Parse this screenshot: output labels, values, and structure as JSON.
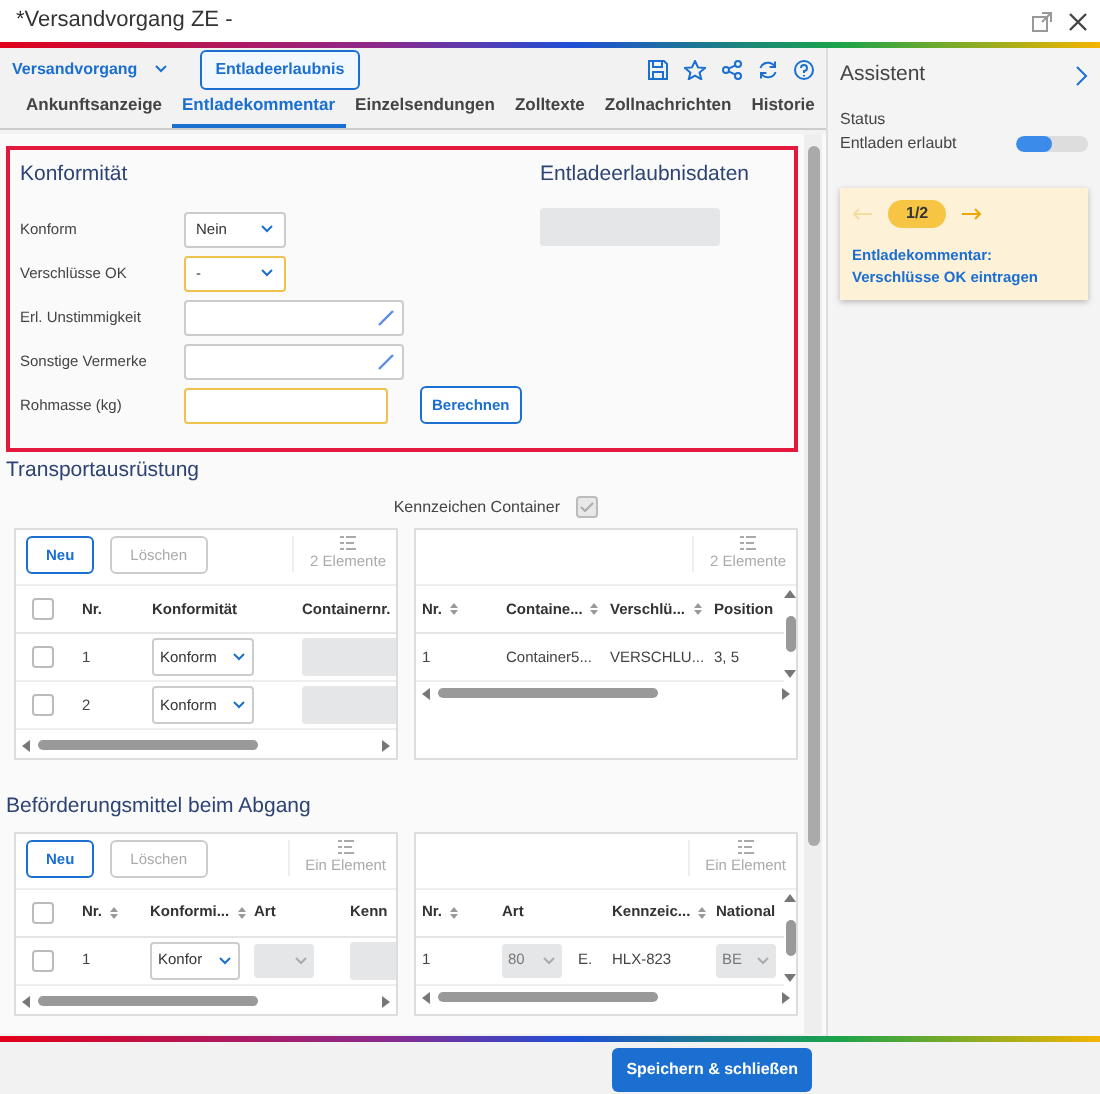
{
  "window": {
    "title": "*Versandvorgang ZE -"
  },
  "toolbar": {
    "menu": "Versandvorgang",
    "button": "Entladeerlaubnis"
  },
  "tabs": [
    {
      "label": "Ankunftsanzeige",
      "selected": false
    },
    {
      "label": "Entladekommentar",
      "selected": true
    },
    {
      "label": "Einzelsendungen",
      "selected": false
    },
    {
      "label": "Zolltexte",
      "selected": false
    },
    {
      "label": "Zollnachrichten",
      "selected": false
    },
    {
      "label": "Historie",
      "selected": false
    }
  ],
  "konformitaet": {
    "title": "Konformität",
    "highlighted": true,
    "fields": [
      {
        "label": "Konform",
        "kind": "select",
        "value": "Nein",
        "required": false
      },
      {
        "label": "Verschlüsse OK",
        "kind": "select",
        "value": "-",
        "required": true
      },
      {
        "label": "Erl. Unstimmigkeit",
        "kind": "text",
        "required": false
      },
      {
        "label": "Sonstige Vermerke",
        "kind": "text",
        "required": false
      },
      {
        "label": "Rohmasse (kg)",
        "kind": "number",
        "required": true,
        "button": "Berechnen"
      }
    ]
  },
  "entladeerlaubnisdaten": {
    "title": "Entladeerlaubnisdaten",
    "field": {
      "disabled": true
    }
  },
  "sections": [
    {
      "title": "Transportausrüstung",
      "checkbox": {
        "label": "Kennzeichen Container",
        "checked": true,
        "disabled": true
      },
      "tables": [
        {
          "buttons": [
            {
              "label": "Neu",
              "disabled": false
            },
            {
              "label": "Löschen",
              "disabled": true
            }
          ],
          "count": "2 Elemente",
          "select_all": {
            "checked": false
          },
          "columns": [
            {
              "label": "Nr.",
              "sortable": false
            },
            {
              "label": "Konformität",
              "sortable": false
            },
            {
              "label": "Containernr."
            }
          ],
          "rows": [
            {
              "selected": false,
              "cells": [
                {
                  "kind": "text",
                  "text": "1"
                },
                {
                  "kind": "select",
                  "text": "Konform"
                },
                {
                  "kind": "blank"
                }
              ]
            },
            {
              "selected": false,
              "cells": [
                {
                  "kind": "text",
                  "text": "2"
                },
                {
                  "kind": "select",
                  "text": "Konform"
                },
                {
                  "kind": "blank"
                }
              ]
            }
          ]
        },
        {
          "count": "2 Elemente",
          "columns": [
            {
              "label": "Nr.",
              "sortable": true
            },
            {
              "label": "Containe...",
              "sortable": true
            },
            {
              "label": "Verschlü...",
              "sortable": true
            },
            {
              "label": "Position",
              "sortable": false
            }
          ],
          "rows": [
            {
              "cells": [
                {
                  "kind": "text",
                  "text": "1"
                },
                {
                  "kind": "text",
                  "text": "Container5..."
                },
                {
                  "kind": "text",
                  "text": "VERSCHLU..."
                },
                {
                  "kind": "text",
                  "text": "3, 5"
                }
              ]
            }
          ]
        }
      ]
    },
    {
      "title": "Beförderungsmittel beim Abgang",
      "tables": [
        {
          "buttons": [
            {
              "label": "Neu",
              "disabled": false
            },
            {
              "label": "Löschen",
              "disabled": true
            }
          ],
          "count": "Ein Element",
          "select_all": {
            "checked": false
          },
          "columns": [
            {
              "label": "Nr.",
              "sortable": true
            },
            {
              "label": "Konformi...",
              "sortable": true
            },
            {
              "label": "Art",
              "sortable": false
            },
            {
              "label": "Kenn"
            }
          ],
          "rows": [
            {
              "selected": false,
              "cells": [
                {
                  "kind": "text",
                  "text": "1"
                },
                {
                  "kind": "select",
                  "text": "Konfor"
                },
                {
                  "kind": "disabled_select"
                },
                {
                  "kind": "blank"
                }
              ]
            }
          ]
        },
        {
          "count": "Ein Element",
          "columns": [
            {
              "label": "Nr.",
              "sortable": true
            },
            {
              "label": "Art",
              "sortable": false
            },
            {
              "label": "Kennzeic...",
              "sortable": true
            },
            {
              "label": "National"
            }
          ],
          "rows": [
            {
              "cells": [
                {
                  "kind": "text",
                  "text": "1"
                },
                {
                  "kind": "disabled_select",
                  "text": "80",
                  "suffix": "E."
                },
                {
                  "kind": "text",
                  "text": "HLX-823"
                },
                {
                  "kind": "disabled_select",
                  "text": "BE"
                }
              ]
            }
          ]
        }
      ]
    }
  ],
  "assistant": {
    "title": "Assistent",
    "status_label": "Status",
    "status": "Entladen erlaubt",
    "level": 0.5,
    "card": {
      "pager": "1/2",
      "prev_disabled": true,
      "next_disabled": false,
      "link": "Entladekommentar: Verschlüsse OK eintragen"
    }
  },
  "footer": {
    "button": "Speichern & schließen"
  }
}
